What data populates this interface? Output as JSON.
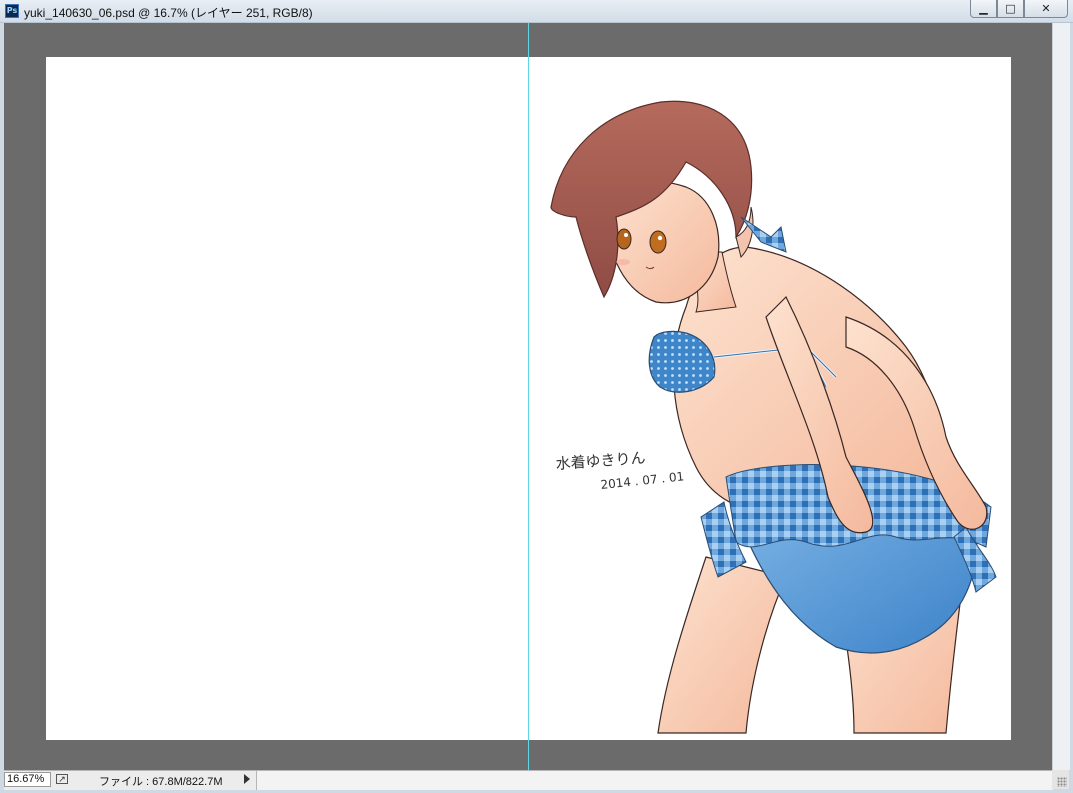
{
  "window": {
    "title": "yuki_140630_06.psd @ 16.7% (レイヤー 251, RGB/8)",
    "app_icon": "Ps",
    "buttons": {
      "minimize": "▁",
      "maximize": "□",
      "close": "✕"
    }
  },
  "artwork": {
    "signature": "水着ゆきりん",
    "date": "2014 . 07 . 01"
  },
  "statusbar": {
    "zoom": "16.67%",
    "file_info": "ファイル : 67.8M/822.7M"
  },
  "colors": {
    "canvas_bg": "#6b6b6b",
    "guide": "#5fd6e6",
    "document": "#ffffff"
  }
}
